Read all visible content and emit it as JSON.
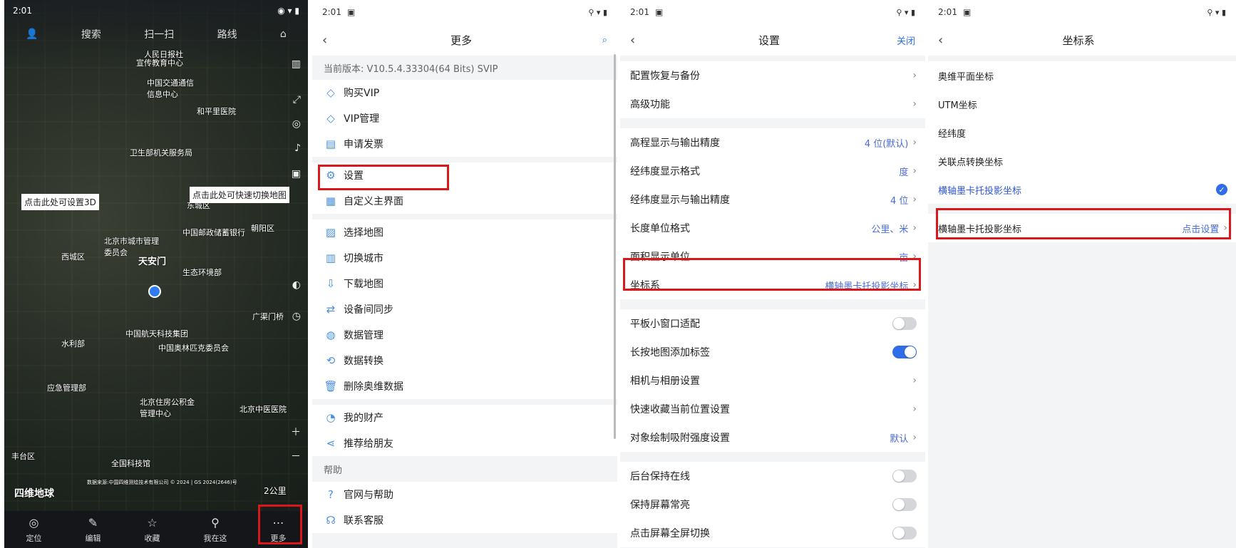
{
  "map": {
    "status_time": "2:01",
    "nav": [
      "搜索",
      "扫一扫",
      "路线"
    ],
    "hint_3d": "点击此处可设置3D",
    "hint_switch": "点击此处可快速切换地图",
    "place": "天安门",
    "labels": [
      "人民日报社",
      "宣传教育中心",
      "中国交通通信信息中心",
      "和平里医院",
      "卫生部机关服务局",
      "东城区",
      "中国邮政储蓄银行",
      "北京市城市管理委员会",
      "西城区",
      "朝阳区",
      "生态环境部",
      "中国航天科技集团",
      "广渠门桥",
      "水利部",
      "中国奥林匹克委员会",
      "应急管理部",
      "北京住房公积金管理中心",
      "北京中医医院",
      "丰台区",
      "全国科技馆"
    ],
    "scale": "2公里",
    "brand": "四维地球",
    "credit": "数据来源:中国四维测绘技术有限公司 © 2024 | GS 2024(2646)号",
    "bottom": [
      "定位",
      "编辑",
      "收藏",
      "我在这",
      "更多"
    ]
  },
  "more": {
    "status_time": "2:01",
    "title": "更多",
    "version": "当前版本: V10.5.4.33304(64 Bits) SVIP",
    "groups": [
      [
        "购买VIP",
        "VIP管理",
        "申请发票"
      ],
      [
        "设置",
        "自定义主界面"
      ],
      [
        "选择地图",
        "切换城市",
        "下载地图",
        "设备间同步",
        "数据管理",
        "数据转换",
        "删除奥维数据"
      ],
      [
        "我的财产",
        "推荐给朋友"
      ]
    ],
    "help_header": "帮助",
    "help": [
      "官网与帮助",
      "联系客服"
    ]
  },
  "settings": {
    "status_time": "2:01",
    "title": "设置",
    "close": "关闭",
    "rows": [
      {
        "label": "配置恢复与备份",
        "value": ""
      },
      {
        "label": "高级功能",
        "value": ""
      },
      {
        "label": "高程显示与输出精度",
        "value": "4 位(默认)"
      },
      {
        "label": "经纬度显示格式",
        "value": "度"
      },
      {
        "label": "经纬度显示与输出精度",
        "value": "4 位"
      },
      {
        "label": "长度单位格式",
        "value": "公里、米"
      },
      {
        "label": "面积显示单位",
        "value": "亩"
      },
      {
        "label": "坐标系",
        "value": "横轴墨卡托投影坐标"
      },
      {
        "label": "平板小窗口适配",
        "value": ""
      },
      {
        "label": "长按地图添加标签",
        "value": ""
      },
      {
        "label": "相机与相册设置",
        "value": ""
      },
      {
        "label": "快速收藏当前位置设置",
        "value": ""
      },
      {
        "label": "对象绘制吸附强度设置",
        "value": "默认"
      },
      {
        "label": "后台保持在线",
        "value": ""
      },
      {
        "label": "保持屏幕常亮",
        "value": ""
      },
      {
        "label": "点击屏幕全屏切换",
        "value": ""
      }
    ]
  },
  "coords": {
    "status_time": "2:01",
    "title": "坐标系",
    "options": [
      "奥维平面坐标",
      "UTM坐标",
      "经纬度",
      "关联点转换坐标",
      "横轴墨卡托投影坐标"
    ],
    "setting_label": "横轴墨卡托投影坐标",
    "setting_value": "点击设置"
  }
}
